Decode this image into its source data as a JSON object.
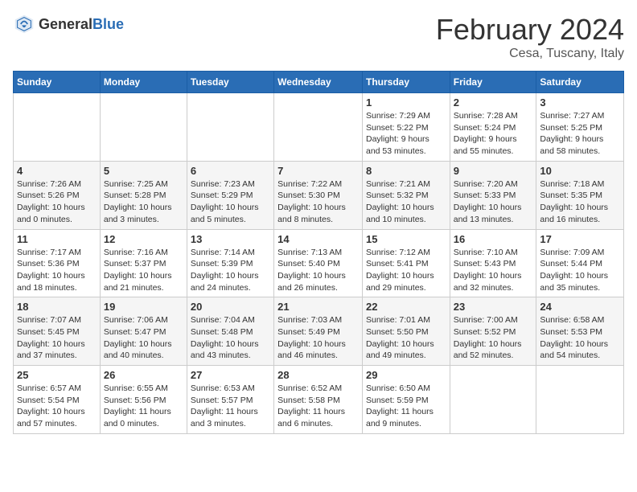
{
  "header": {
    "logo_general": "General",
    "logo_blue": "Blue",
    "month_year": "February 2024",
    "location": "Cesa, Tuscany, Italy"
  },
  "columns": [
    "Sunday",
    "Monday",
    "Tuesday",
    "Wednesday",
    "Thursday",
    "Friday",
    "Saturday"
  ],
  "weeks": [
    [
      {
        "day": "",
        "info": ""
      },
      {
        "day": "",
        "info": ""
      },
      {
        "day": "",
        "info": ""
      },
      {
        "day": "",
        "info": ""
      },
      {
        "day": "1",
        "info": "Sunrise: 7:29 AM\nSunset: 5:22 PM\nDaylight: 9 hours\nand 53 minutes."
      },
      {
        "day": "2",
        "info": "Sunrise: 7:28 AM\nSunset: 5:24 PM\nDaylight: 9 hours\nand 55 minutes."
      },
      {
        "day": "3",
        "info": "Sunrise: 7:27 AM\nSunset: 5:25 PM\nDaylight: 9 hours\nand 58 minutes."
      }
    ],
    [
      {
        "day": "4",
        "info": "Sunrise: 7:26 AM\nSunset: 5:26 PM\nDaylight: 10 hours\nand 0 minutes."
      },
      {
        "day": "5",
        "info": "Sunrise: 7:25 AM\nSunset: 5:28 PM\nDaylight: 10 hours\nand 3 minutes."
      },
      {
        "day": "6",
        "info": "Sunrise: 7:23 AM\nSunset: 5:29 PM\nDaylight: 10 hours\nand 5 minutes."
      },
      {
        "day": "7",
        "info": "Sunrise: 7:22 AM\nSunset: 5:30 PM\nDaylight: 10 hours\nand 8 minutes."
      },
      {
        "day": "8",
        "info": "Sunrise: 7:21 AM\nSunset: 5:32 PM\nDaylight: 10 hours\nand 10 minutes."
      },
      {
        "day": "9",
        "info": "Sunrise: 7:20 AM\nSunset: 5:33 PM\nDaylight: 10 hours\nand 13 minutes."
      },
      {
        "day": "10",
        "info": "Sunrise: 7:18 AM\nSunset: 5:35 PM\nDaylight: 10 hours\nand 16 minutes."
      }
    ],
    [
      {
        "day": "11",
        "info": "Sunrise: 7:17 AM\nSunset: 5:36 PM\nDaylight: 10 hours\nand 18 minutes."
      },
      {
        "day": "12",
        "info": "Sunrise: 7:16 AM\nSunset: 5:37 PM\nDaylight: 10 hours\nand 21 minutes."
      },
      {
        "day": "13",
        "info": "Sunrise: 7:14 AM\nSunset: 5:39 PM\nDaylight: 10 hours\nand 24 minutes."
      },
      {
        "day": "14",
        "info": "Sunrise: 7:13 AM\nSunset: 5:40 PM\nDaylight: 10 hours\nand 26 minutes."
      },
      {
        "day": "15",
        "info": "Sunrise: 7:12 AM\nSunset: 5:41 PM\nDaylight: 10 hours\nand 29 minutes."
      },
      {
        "day": "16",
        "info": "Sunrise: 7:10 AM\nSunset: 5:43 PM\nDaylight: 10 hours\nand 32 minutes."
      },
      {
        "day": "17",
        "info": "Sunrise: 7:09 AM\nSunset: 5:44 PM\nDaylight: 10 hours\nand 35 minutes."
      }
    ],
    [
      {
        "day": "18",
        "info": "Sunrise: 7:07 AM\nSunset: 5:45 PM\nDaylight: 10 hours\nand 37 minutes."
      },
      {
        "day": "19",
        "info": "Sunrise: 7:06 AM\nSunset: 5:47 PM\nDaylight: 10 hours\nand 40 minutes."
      },
      {
        "day": "20",
        "info": "Sunrise: 7:04 AM\nSunset: 5:48 PM\nDaylight: 10 hours\nand 43 minutes."
      },
      {
        "day": "21",
        "info": "Sunrise: 7:03 AM\nSunset: 5:49 PM\nDaylight: 10 hours\nand 46 minutes."
      },
      {
        "day": "22",
        "info": "Sunrise: 7:01 AM\nSunset: 5:50 PM\nDaylight: 10 hours\nand 49 minutes."
      },
      {
        "day": "23",
        "info": "Sunrise: 7:00 AM\nSunset: 5:52 PM\nDaylight: 10 hours\nand 52 minutes."
      },
      {
        "day": "24",
        "info": "Sunrise: 6:58 AM\nSunset: 5:53 PM\nDaylight: 10 hours\nand 54 minutes."
      }
    ],
    [
      {
        "day": "25",
        "info": "Sunrise: 6:57 AM\nSunset: 5:54 PM\nDaylight: 10 hours\nand 57 minutes."
      },
      {
        "day": "26",
        "info": "Sunrise: 6:55 AM\nSunset: 5:56 PM\nDaylight: 11 hours\nand 0 minutes."
      },
      {
        "day": "27",
        "info": "Sunrise: 6:53 AM\nSunset: 5:57 PM\nDaylight: 11 hours\nand 3 minutes."
      },
      {
        "day": "28",
        "info": "Sunrise: 6:52 AM\nSunset: 5:58 PM\nDaylight: 11 hours\nand 6 minutes."
      },
      {
        "day": "29",
        "info": "Sunrise: 6:50 AM\nSunset: 5:59 PM\nDaylight: 11 hours\nand 9 minutes."
      },
      {
        "day": "",
        "info": ""
      },
      {
        "day": "",
        "info": ""
      }
    ]
  ]
}
